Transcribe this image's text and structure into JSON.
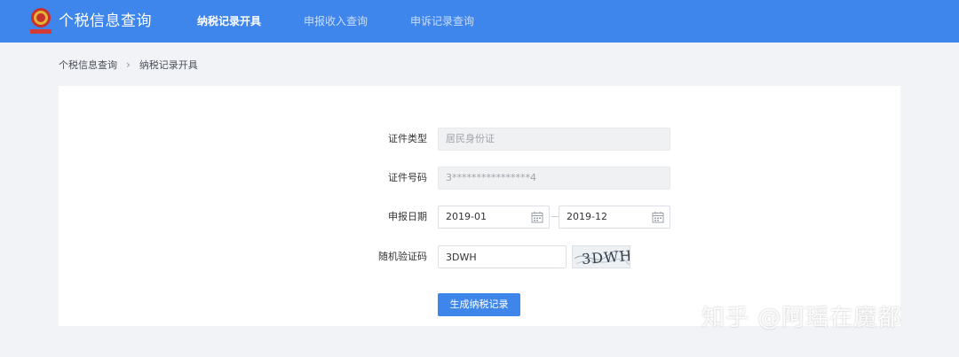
{
  "header": {
    "app_title": "个税信息查询",
    "nav": [
      {
        "label": "纳税记录开具",
        "active": true
      },
      {
        "label": "申报收入查询",
        "active": false
      },
      {
        "label": "申诉记录查询",
        "active": false
      }
    ]
  },
  "breadcrumb": {
    "root": "个税信息查询",
    "current": "纳税记录开具"
  },
  "form": {
    "id_type": {
      "label": "证件类型",
      "value": "居民身份证"
    },
    "id_number": {
      "label": "证件号码",
      "value": "3****************4"
    },
    "date": {
      "label": "申报日期",
      "start": "2019-01",
      "end": "2019-12"
    },
    "captcha": {
      "label": "随机验证码",
      "value": "3DWH",
      "image_text": "3DWH"
    },
    "submit_label": "生成纳税记录"
  },
  "watermark": "知乎 @阿瑶在魔都",
  "colors": {
    "brand": "#3f86ec",
    "background": "#f1f3f6"
  }
}
